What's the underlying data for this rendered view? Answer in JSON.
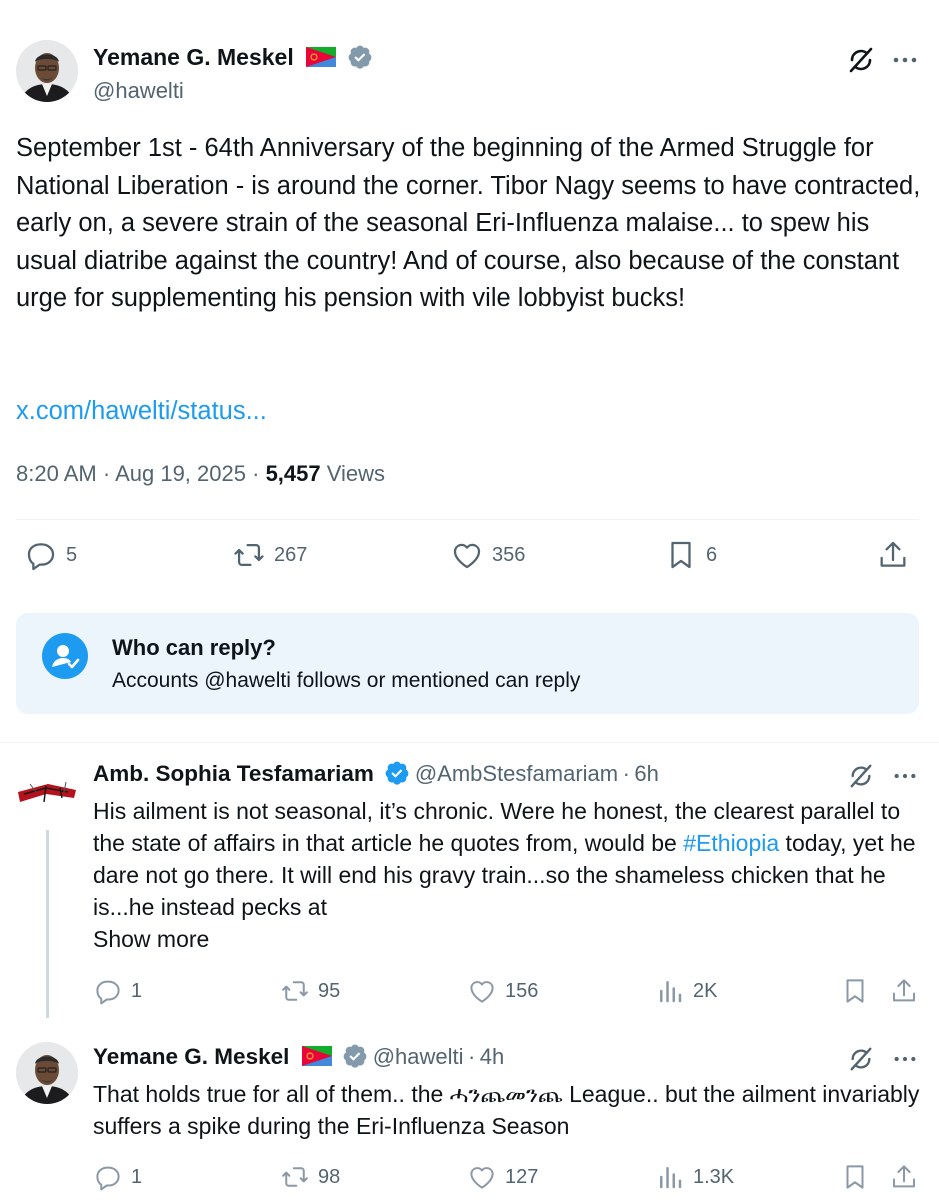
{
  "main_tweet": {
    "author_name": "Yemane G. Meskel",
    "handle": "@hawelti",
    "text": "September 1st - 64th Anniversary of the beginning of the Armed Struggle for National Liberation - is around the corner.  Tibor Nagy seems to have contracted, early on, a severe strain of the seasonal Eri-Influenza malaise... to spew his usual diatribe against the country!  And of course, also because of the constant urge for supplementing his pension with vile lobbyist bucks!",
    "link": "x.com/hawelti/status...",
    "time": "8:20 AM",
    "sep": "·",
    "date": "Aug 19, 2025",
    "sep2": "·",
    "views_count": "5,457",
    "views_label": "Views",
    "replies": "5",
    "reposts": "267",
    "likes": "356",
    "bookmarks": "6"
  },
  "who_can_reply": {
    "title": "Who can reply?",
    "description": "Accounts @hawelti follows or mentioned can reply"
  },
  "replies": [
    {
      "author_name": "Amb. Sophia Tesfamariam",
      "handle": "@AmbStesfamariam",
      "dot": "·",
      "time": "6h",
      "text_before": "His ailment is not seasonal, it’s chronic. Were he honest, the clearest parallel to the state of affairs in that article he quotes from, would be ",
      "hashtag": "#Ethiopia",
      "text_after": " today, yet he dare not go there. It will end his gravy train...so the shameless chicken that he is...he instead pecks at",
      "show_more": "Show more",
      "replies": "1",
      "reposts": "95",
      "likes": "156",
      "views": "2K"
    },
    {
      "author_name": "Yemane G. Meskel",
      "handle": "@hawelti",
      "dot": "·",
      "time": "4h",
      "text": "That holds true for all of them..  the ሓንጨመንጨ League.. but the ailment invariably suffers a spike during the Eri-Influenza Season",
      "replies": "1",
      "reposts": "98",
      "likes": "127",
      "views": "1.3K"
    }
  ],
  "colors": {
    "accent": "#1d9bf0",
    "secondary_text": "#536471",
    "info_box_bg": "#ebf5fb"
  },
  "icons": [
    "grok-icon",
    "more-icon",
    "reply-icon",
    "repost-icon",
    "like-icon",
    "bookmark-icon",
    "share-icon",
    "views-icon",
    "verified-icon",
    "eritrea-flag-icon",
    "people-icon"
  ]
}
